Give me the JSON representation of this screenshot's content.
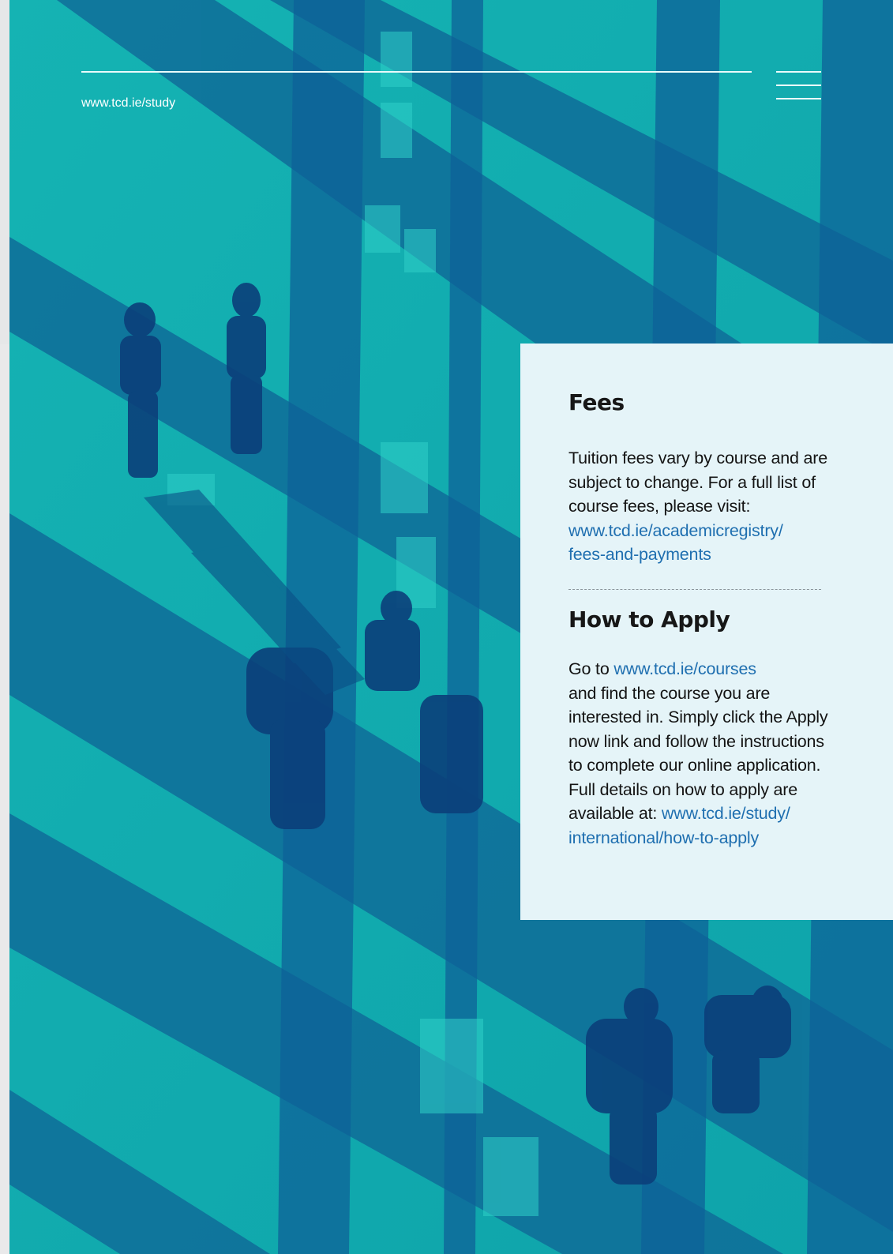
{
  "header": {
    "site_url": "www.tcd.ie/study"
  },
  "photo": {
    "description_icon": "students-walking-photo",
    "tint_light": "#12a9ae",
    "tint_dark": "#0c5a8e"
  },
  "fees": {
    "title": "Fees",
    "body": "Tuition fees vary by course and are subject to change. For a full list of course fees, please visit:",
    "link_line1": "www.tcd.ie/academicregistry/",
    "link_line2": "fees-and-payments"
  },
  "apply": {
    "title": "How to Apply",
    "prefix": "Go to ",
    "courses_link": "www.tcd.ie/courses",
    "body": "and find the course you are interested in. Simply click the Apply now link and follow the instructions to complete our online application. Full details on how to apply are available at: ",
    "link_line1": "www.tcd.ie/study/",
    "link_line2": "international/how-to-apply"
  },
  "colors": {
    "panel_bg": "#e5f4f8",
    "link": "#1f6fb0",
    "text": "#141414"
  }
}
